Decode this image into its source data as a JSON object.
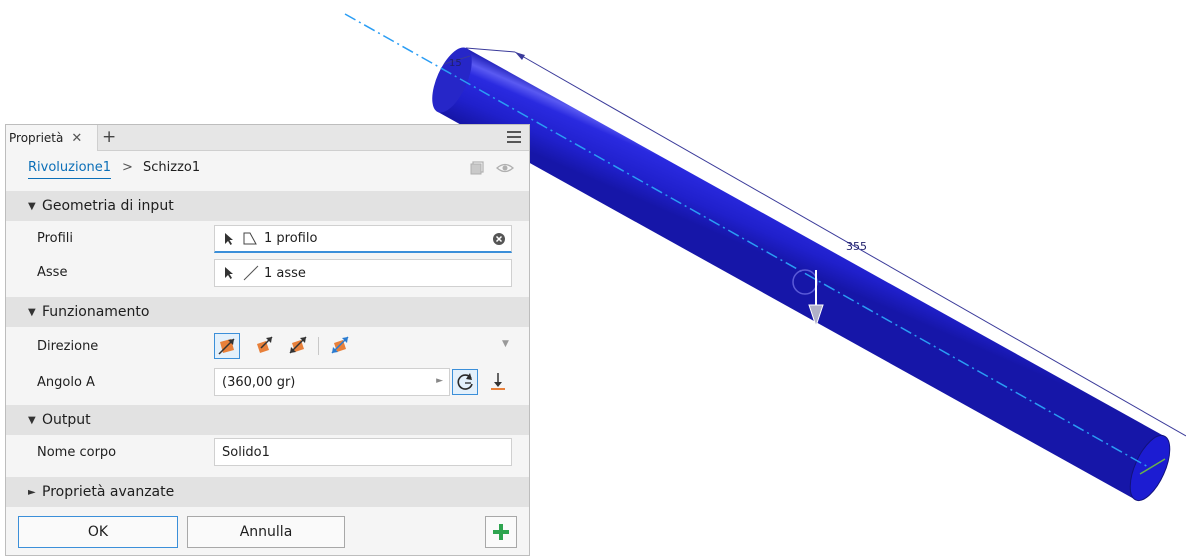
{
  "viewport": {
    "dimension_diameter": "15",
    "dimension_length": "355"
  },
  "panel": {
    "tab_label": "Proprietà",
    "tab_close": "✕",
    "tab_add": "+",
    "breadcrumb_link": "Rivoluzione1",
    "breadcrumb_sep": ">",
    "breadcrumb_current": "Schizzo1",
    "sections": {
      "input_geometry": "Geometria di input",
      "behavior": "Funzionamento",
      "output": "Output",
      "advanced": "Proprietà avanzate"
    },
    "rows": {
      "profiles_label": "Profili",
      "profiles_value": "1 profilo",
      "axis_label": "Asse",
      "axis_value": "1 asse",
      "direction_label": "Direzione",
      "angle_label": "Angolo A",
      "angle_value": "(360,00 gr)",
      "body_name_label": "Nome corpo",
      "body_name_value": "Solido1"
    },
    "buttons": {
      "ok": "OK",
      "cancel": "Annulla"
    }
  },
  "colors": {
    "accent": "#3b8fd9",
    "cylinder": "#2323d8",
    "add_green": "#2ea44f",
    "arrow_orange": "#e8803a"
  }
}
